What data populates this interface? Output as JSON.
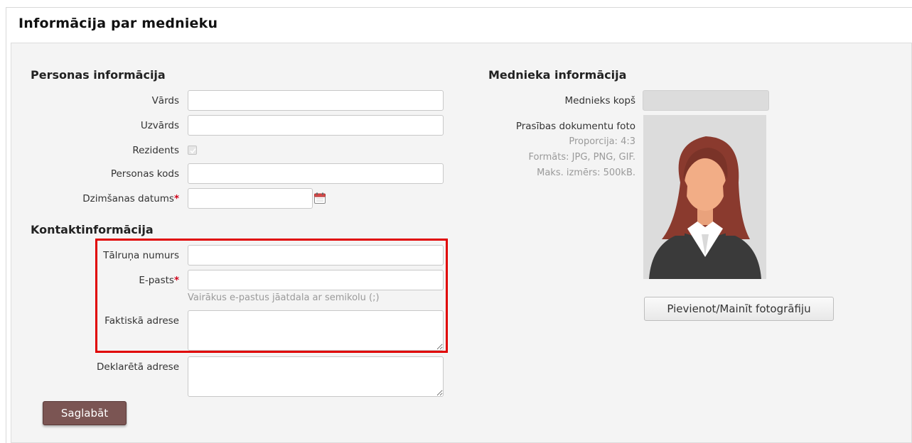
{
  "page": {
    "title": "Informācija par mednieku"
  },
  "personal": {
    "heading": "Personas informācija",
    "first_name": {
      "label": "Vārds",
      "value": ""
    },
    "last_name": {
      "label": "Uzvārds",
      "value": ""
    },
    "resident": {
      "label": "Rezidents",
      "checked": true
    },
    "personal_code": {
      "label": "Personas kods",
      "value": ""
    },
    "birth_date": {
      "label": "Dzimšanas datums",
      "required_mark": "*",
      "value": ""
    }
  },
  "contact": {
    "heading": "Kontaktinformācija",
    "phone": {
      "label": "Tālruņa numurs",
      "value": ""
    },
    "email": {
      "label": "E-pasts",
      "required_mark": "*",
      "value": "",
      "hint": "Vairākus e-pastus jāatdala ar semikolu (;)"
    },
    "actual_address": {
      "label": "Faktiskā adrese",
      "value": ""
    },
    "declared_address": {
      "label": "Deklarētā adrese",
      "value": ""
    }
  },
  "hunter": {
    "heading": "Mednieka informācija",
    "since": {
      "label": "Mednieks kopš",
      "value": ""
    },
    "photo": {
      "label": "Prasības dokumentu foto",
      "proportion": "Proporcija: 4:3",
      "formats": "Formāts: JPG, PNG, GIF.",
      "max_size": "Maks. izmērs: 500kB."
    },
    "photo_button": "Pievienot/Mainīt fotogrāfiju"
  },
  "actions": {
    "save": "Saglabāt"
  },
  "icons": {
    "calendar": "calendar-icon",
    "checkmark": "check-icon",
    "avatar": "female-avatar-placeholder"
  },
  "colors": {
    "highlight": "#e00000",
    "save_button": "#7b5553",
    "required": "#d0021b"
  }
}
